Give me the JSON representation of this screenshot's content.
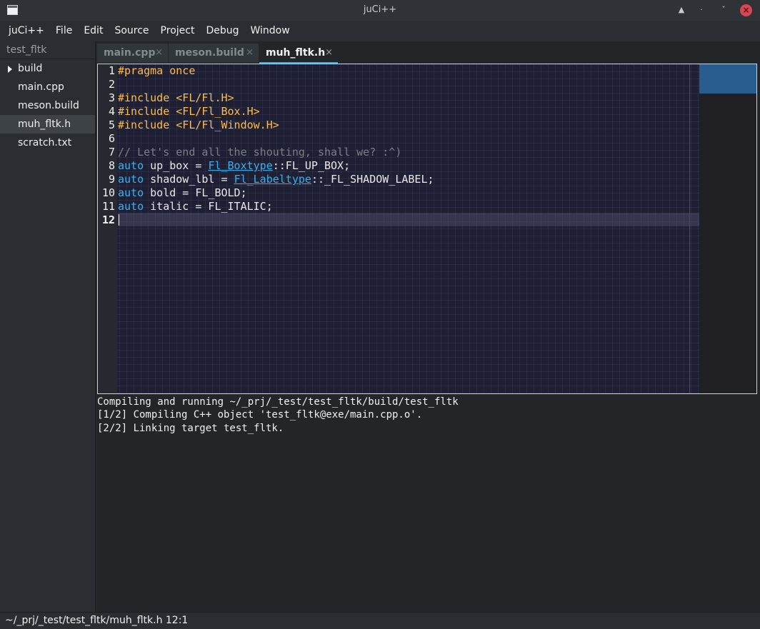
{
  "window": {
    "title": "juCi++",
    "buttons": {
      "keep_above": "▲",
      "minimize": "·",
      "maximize": "ˇ",
      "close": "×"
    }
  },
  "menubar": {
    "items": [
      {
        "label": "juCi++"
      },
      {
        "label": "File"
      },
      {
        "label": "Edit"
      },
      {
        "label": "Source"
      },
      {
        "label": "Project"
      },
      {
        "label": "Debug"
      },
      {
        "label": "Window"
      }
    ]
  },
  "sidebar": {
    "project": "test_fltk",
    "items": [
      {
        "label": "build",
        "type": "folder"
      },
      {
        "label": "main.cpp",
        "type": "file"
      },
      {
        "label": "meson.build",
        "type": "file"
      },
      {
        "label": "muh_fltk.h",
        "type": "file",
        "selected": true
      },
      {
        "label": "scratch.txt",
        "type": "file"
      }
    ]
  },
  "tabs": [
    {
      "label": "main.cpp",
      "close": "×"
    },
    {
      "label": "meson.build",
      "close": "×"
    },
    {
      "label": "muh_fltk.h",
      "close": "×",
      "active": true
    }
  ],
  "editor": {
    "current_line": 12,
    "line_numbers": [
      "1",
      "2",
      "3",
      "4",
      "5",
      "6",
      "7",
      "8",
      "9",
      "10",
      "11",
      "12"
    ],
    "lines": [
      [
        {
          "t": "#pragma once",
          "c": "pp"
        }
      ],
      [],
      [
        {
          "t": "#include <FL/Fl.H>",
          "c": "pp"
        }
      ],
      [
        {
          "t": "#include <FL/Fl_Box.H>",
          "c": "pp"
        }
      ],
      [
        {
          "t": "#include <FL/Fl_Window.H>",
          "c": "pp"
        }
      ],
      [],
      [
        {
          "t": "// Let's end all the shouting, shall we? :^)",
          "c": "cm"
        }
      ],
      [
        {
          "t": "auto",
          "c": "kw"
        },
        {
          "t": " up_box = ",
          "c": "id"
        },
        {
          "t": "Fl_Boxtype",
          "c": "ty"
        },
        {
          "t": "::FL_UP_BOX;",
          "c": "id"
        }
      ],
      [
        {
          "t": "auto",
          "c": "kw"
        },
        {
          "t": " shadow_lbl = ",
          "c": "id"
        },
        {
          "t": "Fl_Labeltype",
          "c": "ty"
        },
        {
          "t": "::_FL_SHADOW_LABEL;",
          "c": "id"
        }
      ],
      [
        {
          "t": "auto",
          "c": "kw"
        },
        {
          "t": " bold = FL_BOLD;",
          "c": "id"
        }
      ],
      [
        {
          "t": "auto",
          "c": "kw"
        },
        {
          "t": " italic = FL_ITALIC;",
          "c": "id"
        }
      ],
      []
    ]
  },
  "terminal": {
    "lines": [
      "Compiling and running ~/_prj/_test/test_fltk/build/test_fltk",
      "[1/2] Compiling C++ object 'test_fltk@exe/main.cpp.o'.",
      "[2/2] Linking target test_fltk."
    ]
  },
  "status": {
    "text": "~/_prj/_test/test_fltk/muh_fltk.h 12:1"
  },
  "colors": {
    "accent": "#3daee9",
    "preprocessor": "#fdbc4b",
    "comment": "#7a7f86",
    "close_button": "#da4453",
    "editor_bg": "#1f1f33"
  }
}
